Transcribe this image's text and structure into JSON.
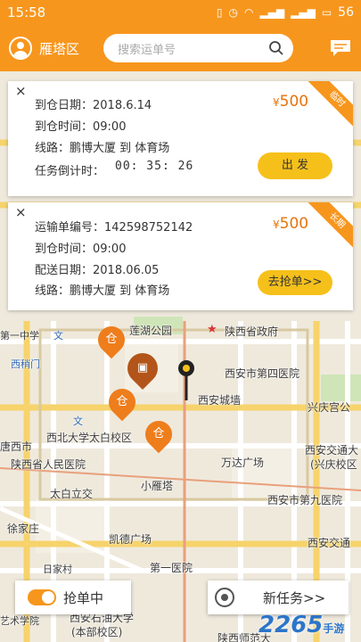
{
  "status_bar": {
    "time": "15:58",
    "battery": "56"
  },
  "header": {
    "district": "雁塔区",
    "search_placeholder": "搜索运单号"
  },
  "cards": [
    {
      "ribbon": "临时",
      "lines": [
        "到仓日期：2018.6.14",
        "到仓时间：09:00",
        "线路：鹏博大厦 到 体育场",
        "任务倒计时："
      ],
      "price_symbol": "¥",
      "price": "500",
      "countdown": "00: 35: 26",
      "button": "出 发"
    },
    {
      "ribbon": "长期",
      "lines": [
        "运输单编号：142598752142",
        "到仓时间：09:00",
        "配送日期：2018.06.05",
        "线路：鹏博大厦 到 体育场"
      ],
      "price_symbol": "¥",
      "price": "500",
      "button": "去抢单>>"
    }
  ],
  "map_labels": {
    "l1": "第一中学",
    "l2": "莲湖公园",
    "l3": "陕西省政府",
    "l4": "西稍门",
    "l5": "西安市第四医院",
    "l6": "西安城墙",
    "l7": "兴庆宫公",
    "l8": "西北大学太白校区",
    "l9": "唐西市",
    "l10": "陕西省人民医院",
    "l11": "万达广场",
    "l12": "西安交通大",
    "l13": "(兴庆校区",
    "l14": "小雁塔",
    "l15": "太白立交",
    "l16": "西安市第九医院",
    "l17": "徐家庄",
    "l18": "凯德广场",
    "l19": "西安交通",
    "l20": "日家村",
    "l21": "第一医院",
    "l22": "西安石油大学",
    "l23": "(本部校区)",
    "l24": "陕西师范大",
    "l25": "艺术学院",
    "l26": "文",
    "l27": "文"
  },
  "bottom": {
    "grab_label": "抢单中",
    "new_task_label": "新任务>>"
  },
  "watermark": {
    "main": "2265",
    "suffix": "手游"
  },
  "colors": {
    "accent": "#f7961d",
    "button": "#f6c01b",
    "price": "#e8730c",
    "countdown": "#e8553a",
    "pin": "#ee7d1c"
  },
  "icons": [
    "avatar-icon",
    "search-icon",
    "message-icon",
    "close-icon",
    "pin-warehouse-icon",
    "truck-pin-icon",
    "location-pin-icon",
    "locate-target-icon"
  ]
}
